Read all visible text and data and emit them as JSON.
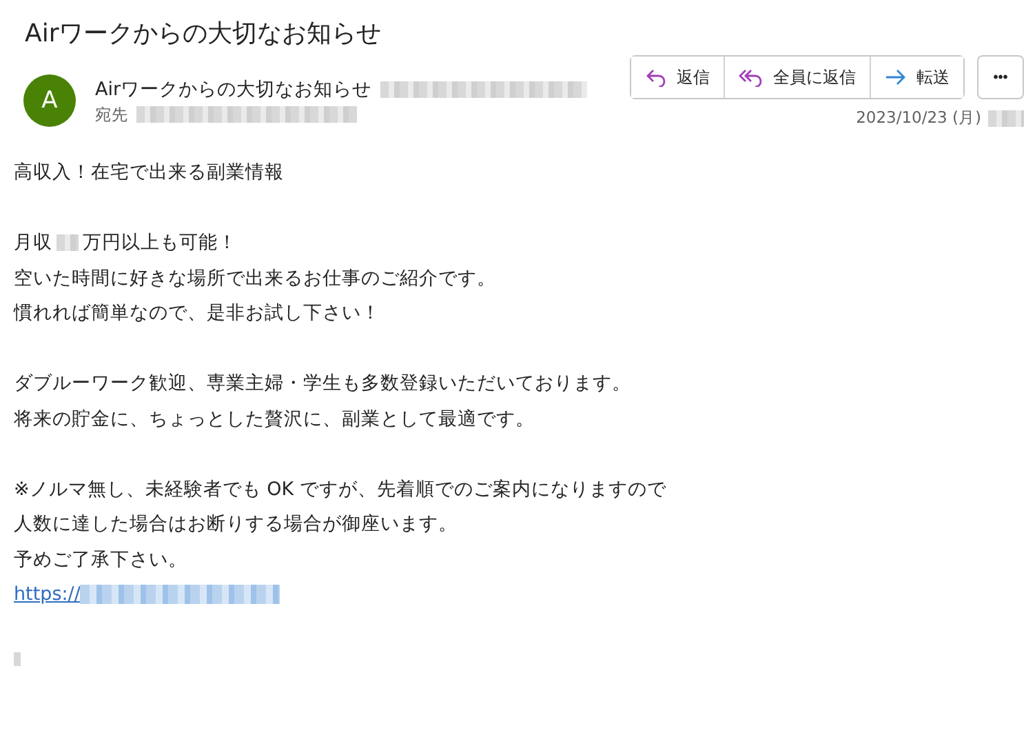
{
  "subject": "Airワークからの大切なお知らせ",
  "sender": {
    "avatar_letter": "A",
    "name": "Airワークからの大切なお知らせ",
    "to_label": "宛先",
    "date": "2023/10/23 (月)"
  },
  "actions": [
    {
      "kind": "reply",
      "label": "返信"
    },
    {
      "kind": "reply_all",
      "label": "全員に返信"
    },
    {
      "kind": "forward",
      "label": "転送"
    }
  ],
  "more_button": "•••",
  "body": [
    [
      [
        {
          "kind": "text",
          "text": "高収入！在宅で出来る副業情報"
        }
      ]
    ],
    [
      [
        {
          "kind": "text",
          "text": "月収"
        },
        {
          "kind": "redacted"
        },
        {
          "kind": "text",
          "text": "万円以上も可能！"
        }
      ],
      [
        {
          "kind": "text",
          "text": "空いた時間に好きな場所で出来るお仕事のご紹介です。"
        }
      ],
      [
        {
          "kind": "text",
          "text": "慣れれば簡単なので、是非お試し下さい！"
        }
      ]
    ],
    [
      [
        {
          "kind": "text",
          "text": "ダブルーワーク歓迎、専業主婦・学生も多数登録いただいております。"
        }
      ],
      [
        {
          "kind": "text",
          "text": "将来の貯金に、ちょっとした贅沢に、副業として最適です。"
        }
      ]
    ],
    [
      [
        {
          "kind": "text",
          "text": "※ノルマ無し、未経験者でも OK ですが、先着順でのご案内になりますので"
        }
      ],
      [
        {
          "kind": "text",
          "text": "人数に達した場合はお断りする場合が御座います。"
        }
      ],
      [
        {
          "kind": "text",
          "text": "予めご了承下さい。"
        }
      ],
      [
        {
          "kind": "link",
          "text": "https://"
        },
        {
          "kind": "redacted_link"
        }
      ]
    ]
  ]
}
